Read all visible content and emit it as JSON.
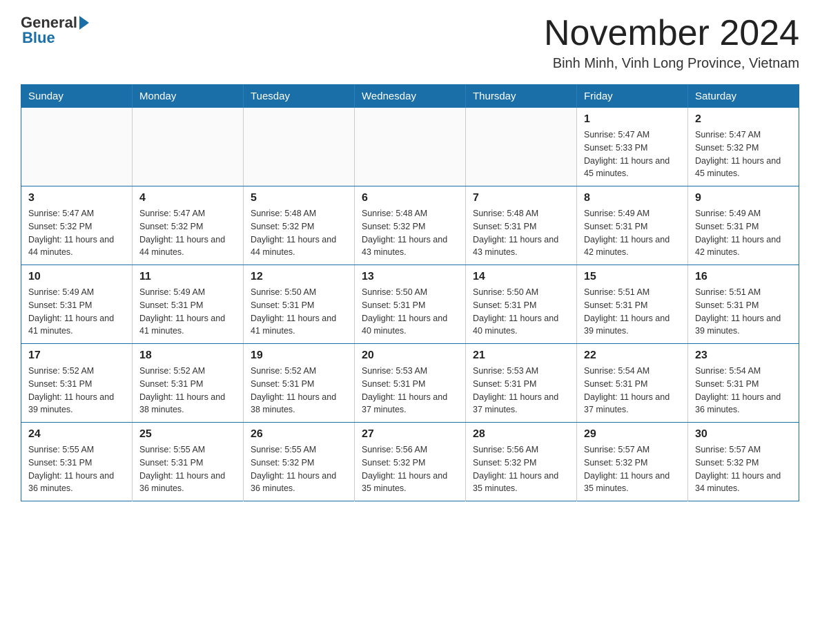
{
  "header": {
    "logo_general": "General",
    "logo_blue": "Blue",
    "month_title": "November 2024",
    "subtitle": "Binh Minh, Vinh Long Province, Vietnam"
  },
  "days_of_week": [
    "Sunday",
    "Monday",
    "Tuesday",
    "Wednesday",
    "Thursday",
    "Friday",
    "Saturday"
  ],
  "weeks": [
    [
      {
        "day": "",
        "info": ""
      },
      {
        "day": "",
        "info": ""
      },
      {
        "day": "",
        "info": ""
      },
      {
        "day": "",
        "info": ""
      },
      {
        "day": "",
        "info": ""
      },
      {
        "day": "1",
        "info": "Sunrise: 5:47 AM\nSunset: 5:33 PM\nDaylight: 11 hours and 45 minutes."
      },
      {
        "day": "2",
        "info": "Sunrise: 5:47 AM\nSunset: 5:32 PM\nDaylight: 11 hours and 45 minutes."
      }
    ],
    [
      {
        "day": "3",
        "info": "Sunrise: 5:47 AM\nSunset: 5:32 PM\nDaylight: 11 hours and 44 minutes."
      },
      {
        "day": "4",
        "info": "Sunrise: 5:47 AM\nSunset: 5:32 PM\nDaylight: 11 hours and 44 minutes."
      },
      {
        "day": "5",
        "info": "Sunrise: 5:48 AM\nSunset: 5:32 PM\nDaylight: 11 hours and 44 minutes."
      },
      {
        "day": "6",
        "info": "Sunrise: 5:48 AM\nSunset: 5:32 PM\nDaylight: 11 hours and 43 minutes."
      },
      {
        "day": "7",
        "info": "Sunrise: 5:48 AM\nSunset: 5:31 PM\nDaylight: 11 hours and 43 minutes."
      },
      {
        "day": "8",
        "info": "Sunrise: 5:49 AM\nSunset: 5:31 PM\nDaylight: 11 hours and 42 minutes."
      },
      {
        "day": "9",
        "info": "Sunrise: 5:49 AM\nSunset: 5:31 PM\nDaylight: 11 hours and 42 minutes."
      }
    ],
    [
      {
        "day": "10",
        "info": "Sunrise: 5:49 AM\nSunset: 5:31 PM\nDaylight: 11 hours and 41 minutes."
      },
      {
        "day": "11",
        "info": "Sunrise: 5:49 AM\nSunset: 5:31 PM\nDaylight: 11 hours and 41 minutes."
      },
      {
        "day": "12",
        "info": "Sunrise: 5:50 AM\nSunset: 5:31 PM\nDaylight: 11 hours and 41 minutes."
      },
      {
        "day": "13",
        "info": "Sunrise: 5:50 AM\nSunset: 5:31 PM\nDaylight: 11 hours and 40 minutes."
      },
      {
        "day": "14",
        "info": "Sunrise: 5:50 AM\nSunset: 5:31 PM\nDaylight: 11 hours and 40 minutes."
      },
      {
        "day": "15",
        "info": "Sunrise: 5:51 AM\nSunset: 5:31 PM\nDaylight: 11 hours and 39 minutes."
      },
      {
        "day": "16",
        "info": "Sunrise: 5:51 AM\nSunset: 5:31 PM\nDaylight: 11 hours and 39 minutes."
      }
    ],
    [
      {
        "day": "17",
        "info": "Sunrise: 5:52 AM\nSunset: 5:31 PM\nDaylight: 11 hours and 39 minutes."
      },
      {
        "day": "18",
        "info": "Sunrise: 5:52 AM\nSunset: 5:31 PM\nDaylight: 11 hours and 38 minutes."
      },
      {
        "day": "19",
        "info": "Sunrise: 5:52 AM\nSunset: 5:31 PM\nDaylight: 11 hours and 38 minutes."
      },
      {
        "day": "20",
        "info": "Sunrise: 5:53 AM\nSunset: 5:31 PM\nDaylight: 11 hours and 37 minutes."
      },
      {
        "day": "21",
        "info": "Sunrise: 5:53 AM\nSunset: 5:31 PM\nDaylight: 11 hours and 37 minutes."
      },
      {
        "day": "22",
        "info": "Sunrise: 5:54 AM\nSunset: 5:31 PM\nDaylight: 11 hours and 37 minutes."
      },
      {
        "day": "23",
        "info": "Sunrise: 5:54 AM\nSunset: 5:31 PM\nDaylight: 11 hours and 36 minutes."
      }
    ],
    [
      {
        "day": "24",
        "info": "Sunrise: 5:55 AM\nSunset: 5:31 PM\nDaylight: 11 hours and 36 minutes."
      },
      {
        "day": "25",
        "info": "Sunrise: 5:55 AM\nSunset: 5:31 PM\nDaylight: 11 hours and 36 minutes."
      },
      {
        "day": "26",
        "info": "Sunrise: 5:55 AM\nSunset: 5:32 PM\nDaylight: 11 hours and 36 minutes."
      },
      {
        "day": "27",
        "info": "Sunrise: 5:56 AM\nSunset: 5:32 PM\nDaylight: 11 hours and 35 minutes."
      },
      {
        "day": "28",
        "info": "Sunrise: 5:56 AM\nSunset: 5:32 PM\nDaylight: 11 hours and 35 minutes."
      },
      {
        "day": "29",
        "info": "Sunrise: 5:57 AM\nSunset: 5:32 PM\nDaylight: 11 hours and 35 minutes."
      },
      {
        "day": "30",
        "info": "Sunrise: 5:57 AM\nSunset: 5:32 PM\nDaylight: 11 hours and 34 minutes."
      }
    ]
  ]
}
